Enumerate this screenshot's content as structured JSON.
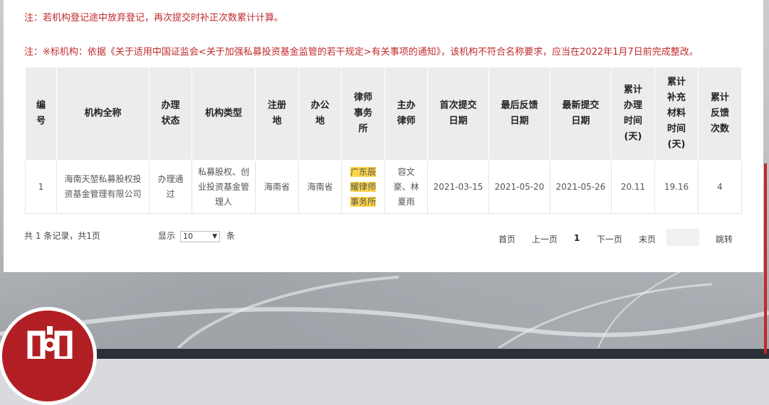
{
  "notes": {
    "note1": "注：若机构登记途中放弃登记，再次提交时补正次数累计计算。",
    "note2": "注：※标机构：依据《关于适用中国证监会<关于加强私募投资基金监管的若干规定>有关事项的通知》，该机构不符合名称要求，应当在2022年1月7日前完成整改。"
  },
  "table": {
    "headers": [
      [
        "编",
        "号"
      ],
      [
        "机构全称"
      ],
      [
        "办理",
        "状态"
      ],
      [
        "机构类型"
      ],
      [
        "注册",
        "地"
      ],
      [
        "办公",
        "地"
      ],
      [
        "律师",
        "事务",
        "所"
      ],
      [
        "主办",
        "律师"
      ],
      [
        "首次提交",
        "日期"
      ],
      [
        "最后反馈",
        "日期"
      ],
      [
        "最新提交",
        "日期"
      ],
      [
        "累计",
        "办理",
        "时间",
        "(天)"
      ],
      [
        "累计",
        "补充",
        "材料",
        "时间",
        "(天)"
      ],
      [
        "累计",
        "反馈",
        "次数"
      ]
    ],
    "rows": [
      {
        "no": "1",
        "name": [
          "海南天堃私募股权投",
          "资基金管理有限公司"
        ],
        "status": [
          "办理通",
          "过"
        ],
        "type": [
          "私募股权、创",
          "业投资基金管",
          "理人"
        ],
        "reg": "海南省",
        "office": "海南省",
        "law_firm": [
          "广东辰",
          "耀律师",
          "事务所"
        ],
        "lawyer": [
          "容文",
          "豪、林",
          "夏雨"
        ],
        "first_submit": "2021-03-15",
        "last_feedback": "2021-05-20",
        "latest_submit": "2021-05-26",
        "days_total": "20.11",
        "days_supplement": "19.16",
        "feedback_count": "4"
      }
    ]
  },
  "pagination": {
    "summary": "共 1 条记录，共1页",
    "show_label": "显示",
    "page_size": "10",
    "unit": "条",
    "first": "首页",
    "prev": "上一页",
    "current": "1",
    "next": "下一页",
    "last": "末页",
    "jump": "跳转"
  },
  "colors": {
    "note_red": "#c0292b",
    "highlight": "#ffd54a",
    "header_bg": "#ececec",
    "logo_red": "#b11f24",
    "footer": "#2b3038"
  }
}
